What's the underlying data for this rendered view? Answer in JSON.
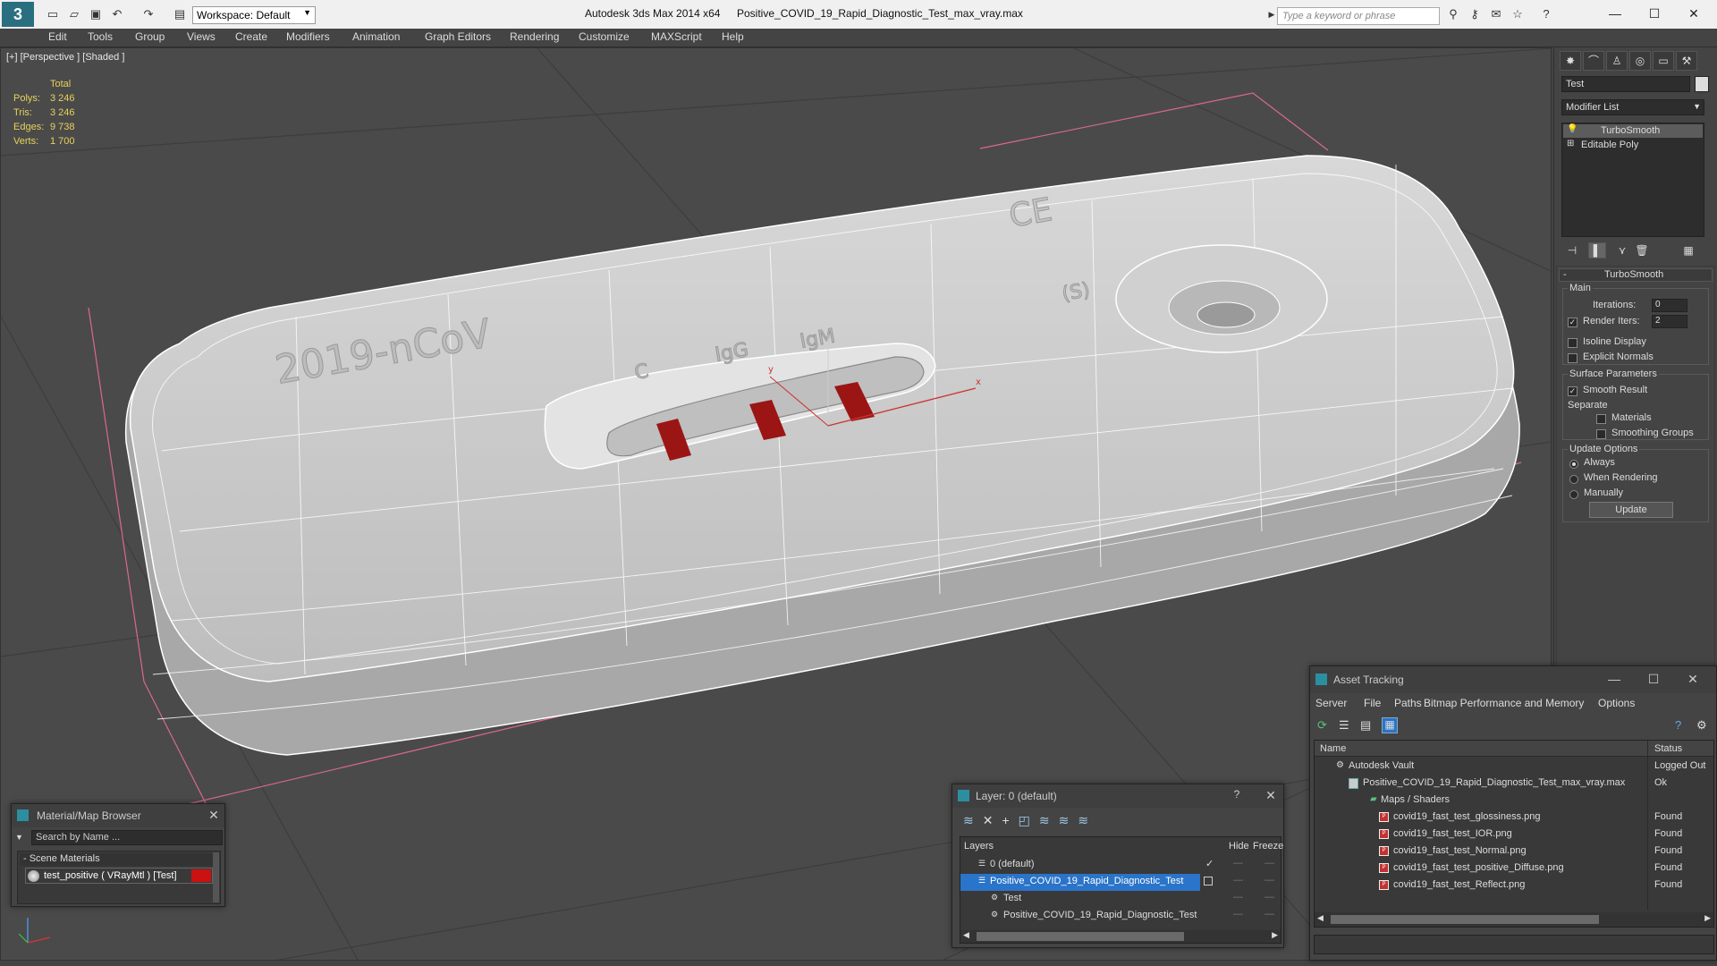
{
  "app": {
    "title": "Autodesk 3ds Max  2014 x64",
    "file": "Positive_COVID_19_Rapid_Diagnostic_Test_max_vray.max",
    "workspace": "Workspace: Default",
    "search_placeholder": "Type a keyword or phrase"
  },
  "menu": [
    "Edit",
    "Tools",
    "Group",
    "Views",
    "Create",
    "Modifiers",
    "Animation",
    "Graph Editors",
    "Rendering",
    "Customize",
    "MAXScript",
    "Help"
  ],
  "viewport": {
    "label": "[+] [Perspective ] [Shaded ]",
    "stats": {
      "total_label": "Total",
      "polys_label": "Polys:",
      "polys": "3 246",
      "tris_label": "Tris:",
      "tris": "3 246",
      "edges_label": "Edges:",
      "edges": "9 738",
      "verts_label": "Verts:",
      "verts": "1 700"
    },
    "model_text": {
      "main": "2019-nCoV",
      "c": "C",
      "igg": "IgG",
      "igm": "IgM",
      "ce": "CE",
      "s": "(S)"
    }
  },
  "command_panel": {
    "object_name": "Test",
    "modifier_list": "Modifier List",
    "stack": [
      "TurboSmooth",
      "Editable Poly"
    ],
    "rollout_title": "TurboSmooth",
    "main_label": "Main",
    "iterations_label": "Iterations:",
    "iterations": "0",
    "render_iters_label": "Render Iters:",
    "render_iters": "2",
    "isoline": "Isoline Display",
    "explicit_normals": "Explicit Normals",
    "surface_params": "Surface Parameters",
    "smooth_result": "Smooth Result",
    "separate": "Separate",
    "materials": "Materials",
    "smoothing_groups": "Smoothing Groups",
    "update_options": "Update Options",
    "always": "Always",
    "when_rendering": "When Rendering",
    "manually": "Manually",
    "update": "Update"
  },
  "material_browser": {
    "title": "Material/Map Browser",
    "search_placeholder": "Search by Name ...",
    "section": "- Scene Materials",
    "item": "test_positive  ( VRayMtl ) [Test]",
    "accent": "#cc1111"
  },
  "layer_window": {
    "title": "Layer: 0 (default)",
    "col_layers": "Layers",
    "col_hide": "Hide",
    "col_freeze": "Freeze",
    "rows": [
      "0 (default)",
      "Positive_COVID_19_Rapid_Diagnostic_Test",
      "Test",
      "Positive_COVID_19_Rapid_Diagnostic_Test"
    ]
  },
  "asset_tracking": {
    "title": "Asset Tracking",
    "menu": [
      "Server",
      "File",
      "Paths",
      "Bitmap Performance and Memory",
      "Options"
    ],
    "col_name": "Name",
    "col_status": "Status",
    "rows": [
      {
        "name": "Autodesk Vault",
        "status": "Logged Out"
      },
      {
        "name": "Positive_COVID_19_Rapid_Diagnostic_Test_max_vray.max",
        "status": "Ok"
      },
      {
        "name": "Maps / Shaders",
        "status": ""
      },
      {
        "name": "covid19_fast_test_glossiness.png",
        "status": "Found"
      },
      {
        "name": "covid19_fast_test_IOR.png",
        "status": "Found"
      },
      {
        "name": "covid19_fast_test_Normal.png",
        "status": "Found"
      },
      {
        "name": "covid19_fast_test_positive_Diffuse.png",
        "status": "Found"
      },
      {
        "name": "covid19_fast_test_Reflect.png",
        "status": "Found"
      }
    ]
  }
}
